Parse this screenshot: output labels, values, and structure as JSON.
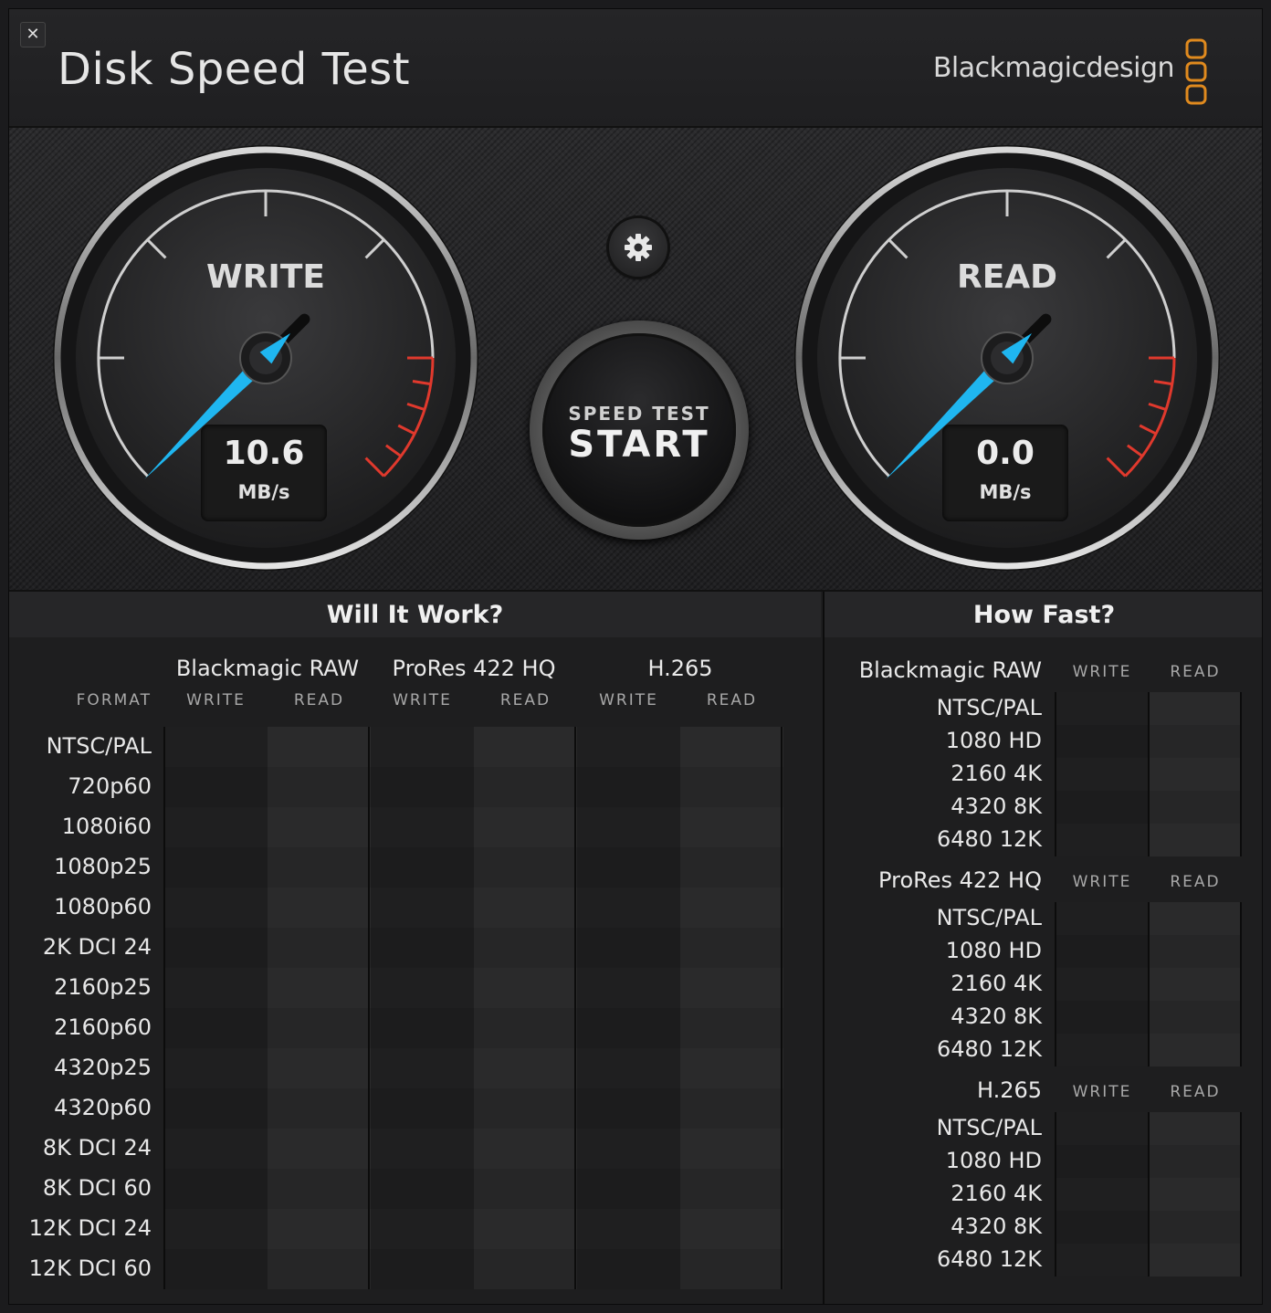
{
  "window": {
    "close_icon": "✕"
  },
  "header": {
    "title": "Disk Speed Test",
    "brand": "Blackmagicdesign",
    "brand_color": "#e08a1e"
  },
  "gauges": {
    "write": {
      "label": "WRITE",
      "value": "10.6",
      "unit": "MB/s"
    },
    "read": {
      "label": "READ",
      "value": "0.0",
      "unit": "MB/s"
    },
    "needle_color": "#1fb6f0",
    "redline_color": "#e0392d"
  },
  "start_button": {
    "line1": "SPEED TEST",
    "line2": "START"
  },
  "will_it_work": {
    "title": "Will It Work?",
    "format_label": "FORMAT",
    "codecs": [
      "Blackmagic RAW",
      "ProRes 422 HQ",
      "H.265"
    ],
    "sub_columns": [
      "WRITE",
      "READ"
    ],
    "formats": [
      "NTSC/PAL",
      "720p60",
      "1080i60",
      "1080p25",
      "1080p60",
      "2K DCI 24",
      "2160p25",
      "2160p60",
      "4320p25",
      "4320p60",
      "8K DCI 24",
      "8K DCI 60",
      "12K DCI 24",
      "12K DCI 60"
    ]
  },
  "how_fast": {
    "title": "How Fast?",
    "sub_columns": [
      "WRITE",
      "READ"
    ],
    "groups": [
      {
        "codec": "Blackmagic RAW",
        "rows": [
          "NTSC/PAL",
          "1080 HD",
          "2160 4K",
          "4320 8K",
          "6480 12K"
        ]
      },
      {
        "codec": "ProRes 422 HQ",
        "rows": [
          "NTSC/PAL",
          "1080 HD",
          "2160 4K",
          "4320 8K",
          "6480 12K"
        ]
      },
      {
        "codec": "H.265",
        "rows": [
          "NTSC/PAL",
          "1080 HD",
          "2160 4K",
          "4320 8K",
          "6480 12K"
        ]
      }
    ]
  }
}
